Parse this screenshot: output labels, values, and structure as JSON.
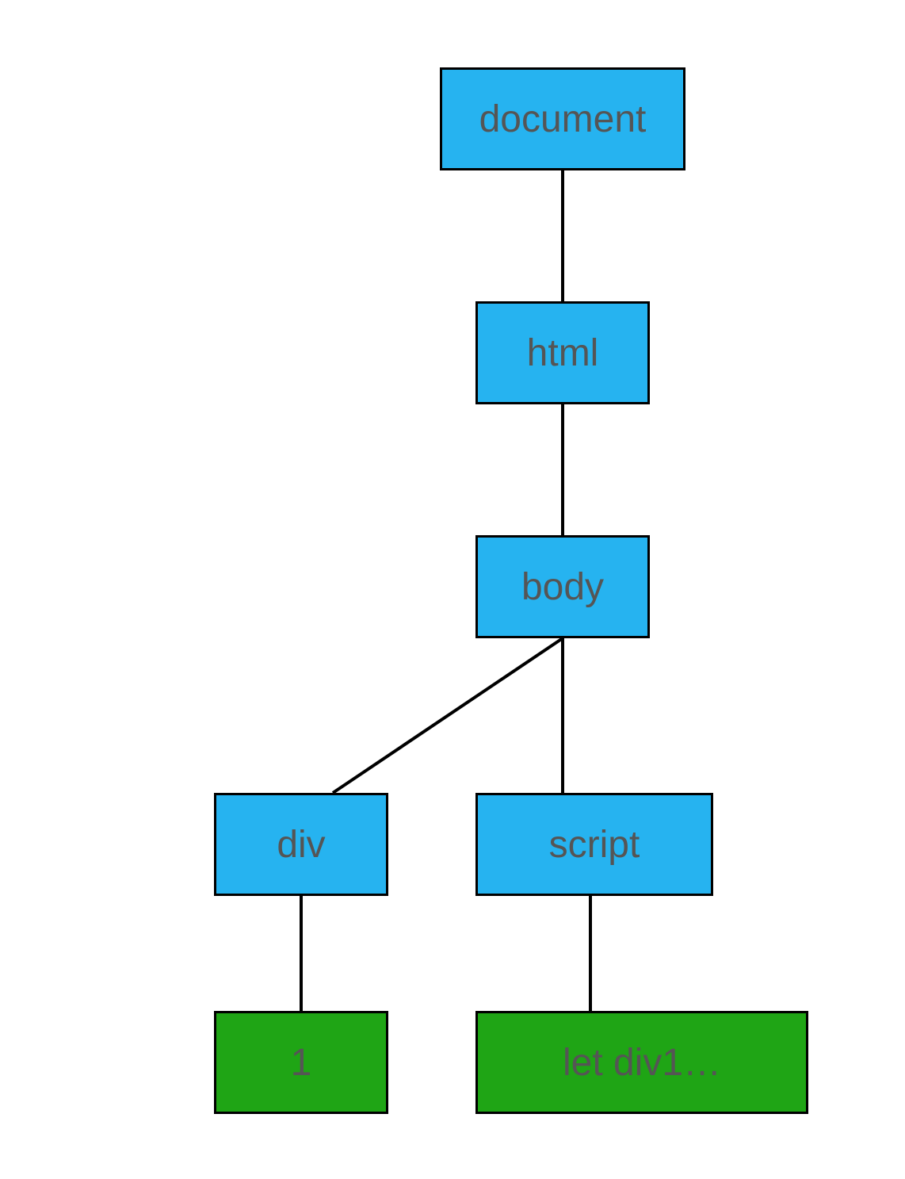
{
  "diagram": {
    "type": "dom-tree",
    "nodes": {
      "document": {
        "label": "document",
        "kind": "element"
      },
      "html": {
        "label": "html",
        "kind": "element"
      },
      "body": {
        "label": "body",
        "kind": "element"
      },
      "div": {
        "label": "div",
        "kind": "element"
      },
      "script": {
        "label": "script",
        "kind": "element"
      },
      "divText": {
        "label": "1",
        "kind": "text"
      },
      "scriptText": {
        "label": "let div1…",
        "kind": "text"
      }
    },
    "edges": [
      [
        "document",
        "html"
      ],
      [
        "html",
        "body"
      ],
      [
        "body",
        "div"
      ],
      [
        "body",
        "script"
      ],
      [
        "div",
        "divText"
      ],
      [
        "script",
        "scriptText"
      ]
    ]
  }
}
